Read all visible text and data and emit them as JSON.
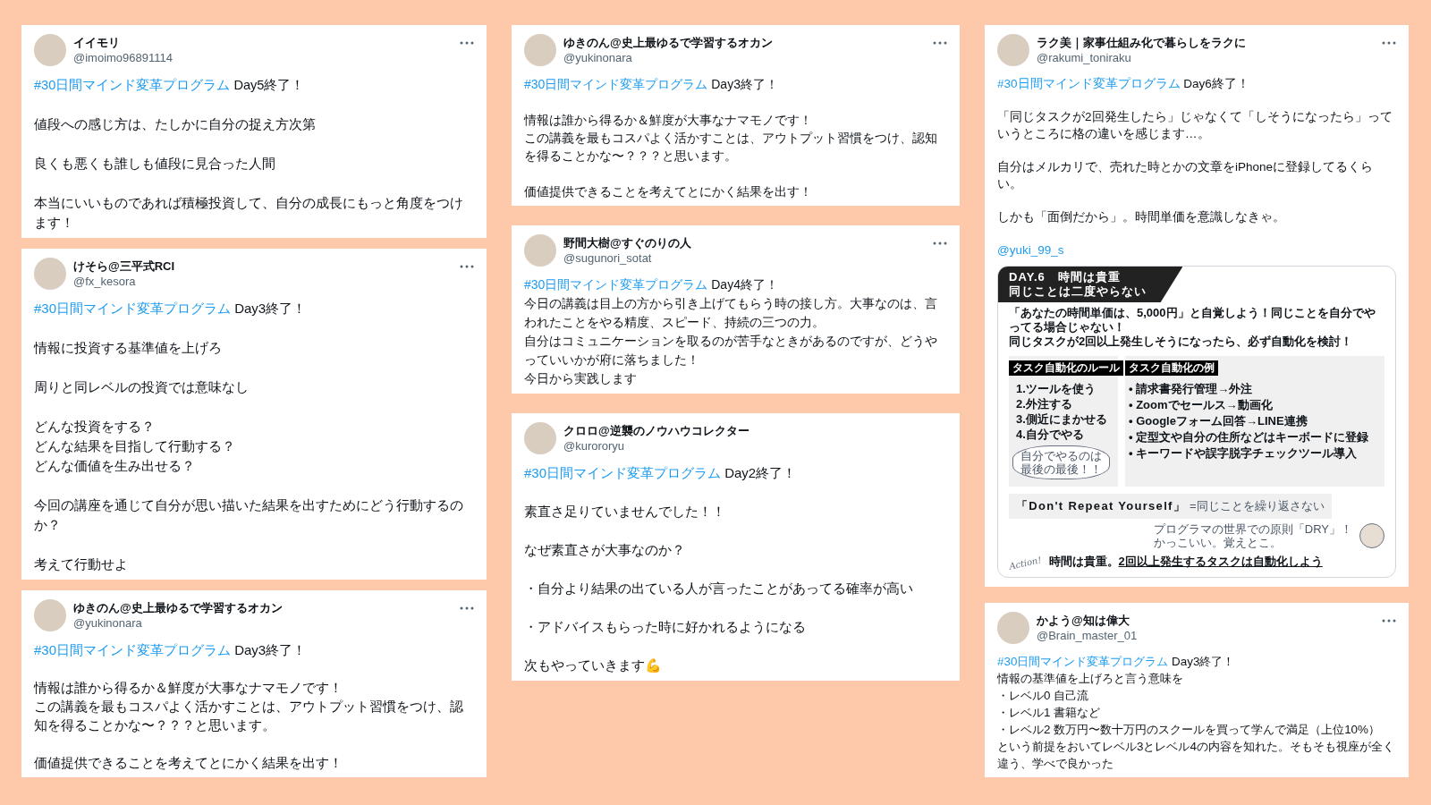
{
  "columns": [
    {
      "tweets": [
        {
          "display_name": "イイモリ",
          "handle": "@imoimo96891114",
          "hashtag": "#30日間マインド変革プログラム",
          "lead": " Day5終了！",
          "spaced": true,
          "menu": true,
          "paragraphs": [
            [
              "値段への感じ方は、たしかに自分の捉え方次第"
            ],
            [
              "良くも悪くも誰しも値段に見合った人間"
            ],
            [
              "本当にいいものであれば積極投資して、自分の成長にもっと角度をつけます！"
            ]
          ]
        },
        {
          "display_name": "けそら@三平式RCI",
          "handle": "@fx_kesora",
          "hashtag": "#30日間マインド変革プログラム",
          "lead": " Day3終了！",
          "spaced": true,
          "menu": true,
          "paragraphs": [
            [
              "情報に投資する基準値を上げろ"
            ],
            [
              "周りと同レベルの投資では意味なし"
            ],
            [
              "どんな投資をする？",
              "どんな結果を目指して行動する？",
              "どんな価値を生み出せる？"
            ],
            [
              "今回の講座を通じて自分が思い描いた結果を出すためにどう行動するのか？"
            ],
            [
              "考えて行動せよ"
            ]
          ]
        },
        {
          "display_name": "ゆきのん@史上最ゆるで学習するオカン",
          "handle": "@yukinonara",
          "hashtag": "#30日間マインド変革プログラム",
          "lead": " Day3終了！",
          "spaced": true,
          "menu": true,
          "paragraphs": [
            [
              "情報は誰から得るか＆鮮度が大事なナマモノです！",
              "この講義を最もコスパよく活かすことは、アウトプット習慣をつけ、認知を得ることかな〜？？？と思います。"
            ],
            [
              "価値提供できることを考えてとにかく結果を出す！"
            ]
          ]
        }
      ]
    },
    {
      "tweets": [
        {
          "display_name": "ゆきのん@史上最ゆるで学習するオカン",
          "handle": "@yukinonara",
          "hashtag": "#30日間マインド変革プログラム",
          "lead": " Day3終了！",
          "spaced": true,
          "menu": true,
          "paragraphs": [
            [
              "情報は誰から得るか＆鮮度が大事なナマモノです！",
              "この講義を最もコスパよく活かすことは、アウトプット習慣をつけ、認知を得ることかな〜？？？と思います。"
            ],
            [
              "価値提供できることを考えてとにかく結果を出す！"
            ]
          ]
        },
        {
          "display_name": "野間大樹@すぐのりの人",
          "handle": "@sugunori_sotat",
          "hashtag": "#30日間マインド変革プログラム",
          "lead": " Day4終了！",
          "spaced": false,
          "menu": true,
          "paragraphs": [
            [
              "今日の講義は目上の方から引き上げてもらう時の接し方。大事なのは、言われたことをやる精度、スピード、持続の三つの力。"
            ],
            [
              "自分はコミュニケーションを取るのが苦手なときがあるのですが、どうやっていいかが府に落ちました！"
            ],
            [
              "今日から実践します"
            ]
          ]
        },
        {
          "display_name": "クロロ@逆襲のノウハウコレクター",
          "handle": "@kurororyu",
          "hashtag": "#30日間マインド変革プログラム",
          "lead": " Day2終了！",
          "spaced": true,
          "menu": false,
          "paragraphs": [
            [
              "素直さ足りていませんでした！！"
            ],
            [
              "なぜ素直さが大事なのか？"
            ],
            [
              "・自分より結果の出ている人が言ったことがあってる確率が高い"
            ],
            [
              "・アドバイスもらった時に好かれるようになる"
            ],
            [
              "次もやっていきます💪"
            ]
          ]
        }
      ]
    },
    {
      "tweets": [
        {
          "display_name": "ラク美｜家事仕組み化で暮らしをラクに",
          "handle": "@rakumi_toniraku",
          "hashtag": "#30日間マインド変革プログラム",
          "lead": " Day6終了！",
          "spaced": true,
          "menu": true,
          "paragraphs": [
            [
              "「同じタスクが2回発生したら」じゃなくて「しそうになったら」っていうところに格の違いを感じます…。"
            ],
            [
              "自分はメルカリで、売れた時とかの文章をiPhoneに登録してるくらい。"
            ],
            [
              "しかも「面倒だから」。時間単価を意識しなきゃ。"
            ]
          ],
          "mention": "@yuki_99_s",
          "image": {
            "kind": "slide",
            "title_lines": [
              "DAY.6　時間は貴重",
              "同じことは二度やらない"
            ],
            "intro": [
              "「あなたの時間単価は、5,000円」と自覚しよう！同じことを自分でやってる場合じゃない！",
              "同じタスクが2回以上発生しそうになったら、必ず自動化を検討！"
            ],
            "rules": {
              "title": "タスク自動化のルール",
              "items": [
                "1.ツールを使う",
                "2.外注する",
                "3.側近にまかせる",
                "4.自分でやる"
              ]
            },
            "bubble": [
              "自分でやるのは",
              "最後の最後！！"
            ],
            "examples": {
              "title": "タスク自動化の例",
              "items": [
                "• 請求書発行管理→外注",
                "• Zoomでセールス→動画化",
                "• Googleフォーム回答→LINE連携",
                "• 定型文や自分の住所などはキーボードに登録",
                "• キーワードや誤字脱字チェックツール導入"
              ]
            },
            "motto": "「Don't Repeat Yourself」",
            "motto_note": "=同じことを繰り返さない",
            "side_note": [
              "プログラマの世界での原則「DRY」！",
              "かっこいい。覚えとこ。"
            ],
            "signature": "Action!",
            "summary_lead": "時間は貴重。",
            "summary_underlined": "2回以上発生するタスクは自動化しよう"
          }
        },
        {
          "display_name": "かよう@知は偉大",
          "handle": "@Brain_master_01",
          "hashtag": "#30日間マインド変革プログラム",
          "lead": " Day3終了！",
          "spaced": false,
          "menu": true,
          "paragraphs": [
            [
              "情報の基準値を上げろと言う意味を"
            ],
            [
              "・レベル0 自己流"
            ],
            [
              "・レベル1 書籍など"
            ],
            [
              "・レベル2 数万円〜数十万円のスクールを買って学んで満足（上位10%）"
            ],
            [
              "という前提をおいてレベル3とレベル4の内容を知れた。そもそも視座が全く違う、学べで良かった"
            ]
          ]
        }
      ]
    }
  ]
}
